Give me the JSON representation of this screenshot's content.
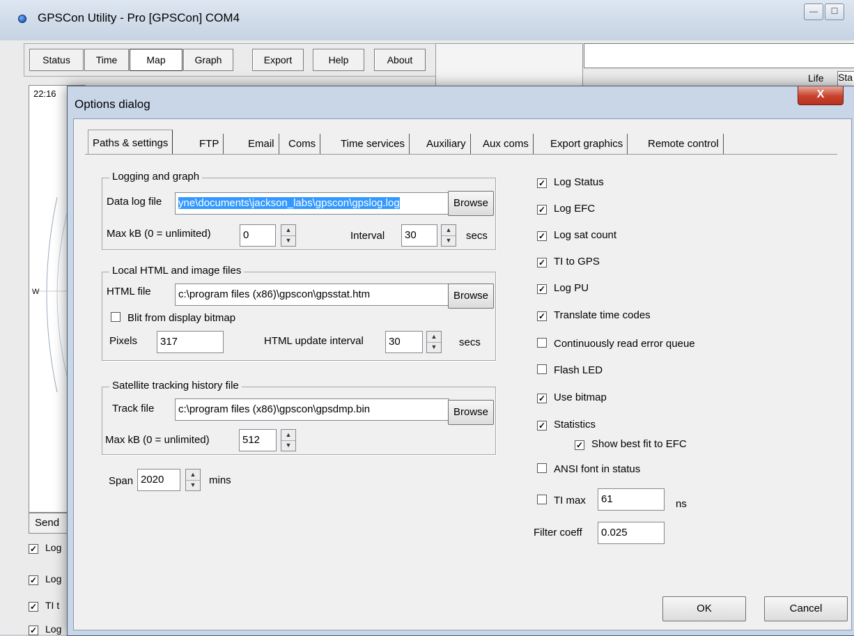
{
  "window": {
    "title": "GPSCon Utility - Pro [GPSCon] COM4",
    "minimize_glyph": "—",
    "maximize_glyph": "☐"
  },
  "toolbar": {
    "status": "Status",
    "time": "Time",
    "map": "Map",
    "graph": "Graph",
    "export": "Export",
    "help": "Help",
    "about": "About"
  },
  "main": {
    "life_label": "Life",
    "life_value": "Sta",
    "map_time": "22:16",
    "map_west": "W",
    "send_label": "Send",
    "bg_checks": [
      {
        "label": "Log",
        "checked": true
      },
      {
        "label": "Log",
        "checked": true
      },
      {
        "label": "TI t",
        "checked": true
      },
      {
        "label": "Log",
        "checked": true
      }
    ]
  },
  "dialog": {
    "title": "Options dialog",
    "close_glyph": "X",
    "tabs": [
      "Paths & settings",
      "FTP",
      "Email",
      "Coms",
      "Time services",
      "Auxiliary",
      "Aux coms",
      "Export graphics",
      "Remote control"
    ],
    "active_tab": "Paths & settings",
    "logging": {
      "group_title": "Logging and graph",
      "data_log_label": "Data log file",
      "data_log_value": "yne\\documents\\jackson_labs\\gpscon\\gpslog.log",
      "browse": "Browse",
      "max_kb_label": "Max kB (0 = unlimited)",
      "max_kb_value": "0",
      "interval_label": "Interval",
      "interval_value": "30",
      "secs": "secs"
    },
    "html": {
      "group_title": "Local HTML and image files",
      "html_file_label": "HTML file",
      "html_file_value": "c:\\program files (x86)\\gpscon\\gpsstat.htm",
      "browse": "Browse",
      "blit_label": "Blit from display bitmap",
      "blit_checked": false,
      "pixels_label": "Pixels",
      "pixels_value": "317",
      "update_label": "HTML update interval",
      "update_value": "30",
      "secs": "secs"
    },
    "track": {
      "group_title": "Satellite tracking history file",
      "track_label": "Track file",
      "track_value": "c:\\program files (x86)\\gpscon\\gpsdmp.bin",
      "browse": "Browse",
      "max_kb_label": "Max  kB (0 = unlimited)",
      "max_kb_value": "512"
    },
    "span": {
      "label": "Span",
      "value": "2020",
      "unit": "mins"
    },
    "options": [
      {
        "label": "Log Status",
        "checked": true
      },
      {
        "label": "Log EFC",
        "checked": true
      },
      {
        "label": "Log sat count",
        "checked": true
      },
      {
        "label": "TI to GPS",
        "checked": true
      },
      {
        "label": "Log PU",
        "checked": true
      },
      {
        "label": "Translate time codes",
        "checked": true
      },
      {
        "label": "Continuously read error queue",
        "checked": false
      },
      {
        "label": "Flash LED",
        "checked": false
      },
      {
        "label": "Use bitmap",
        "checked": true
      },
      {
        "label": "Statistics",
        "checked": true
      },
      {
        "label": "Show best fit to EFC",
        "checked": true
      },
      {
        "label": "ANSI font in status",
        "checked": false
      }
    ],
    "ti_max": {
      "label": "TI max",
      "value": "61",
      "unit": "ns",
      "checked": false
    },
    "filter": {
      "label": "Filter coeff",
      "value": "0.025"
    },
    "ok": "OK",
    "cancel": "Cancel"
  }
}
